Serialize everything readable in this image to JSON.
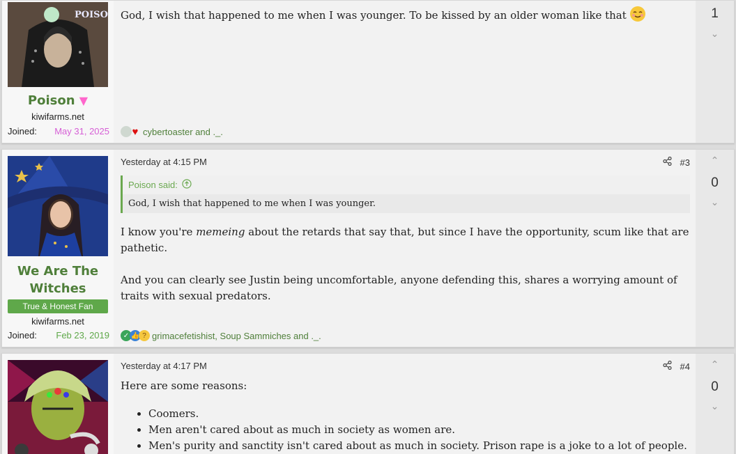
{
  "posts": [
    {
      "username": "Poison",
      "user_flair": "▼",
      "site": "kiwifarms.net",
      "joined_label": "Joined:",
      "joined_date": "May 31, 2025",
      "body": "God, I wish that happened to me when I was younger. To be kissed by an older woman like that",
      "reactions": "cybertoaster and ._.",
      "score": "1"
    },
    {
      "username": "We Are The Witches",
      "badge": "True & Honest Fan",
      "site": "kiwifarms.net",
      "joined_label": "Joined:",
      "joined_date": "Feb 23, 2019",
      "timestamp": "Yesterday at 4:15 PM",
      "post_number": "#3",
      "quote_author": "Poison said:",
      "quote_text": "God, I wish that happened to me when I was younger.",
      "body_p1_a": "I know you're ",
      "body_p1_em": "memeing",
      "body_p1_b": " about the retards that say that, but since I have the opportunity, scum like that are pathetic.",
      "body_p2": "And you can clearly see Justin being uncomfortable, anyone defending this, shares a worrying amount of traits with sexual predators.",
      "reactions": "grimacefetishist, Soup Sammiches and ._.",
      "score": "0"
    },
    {
      "timestamp": "Yesterday at 4:17 PM",
      "post_number": "#4",
      "intro": "Here are some reasons:",
      "list": [
        "Coomers.",
        "Men aren't cared about as much in society as women are.",
        "Men's purity and sanctity isn't cared about as much in society. Prison rape is a joke to a lot of people."
      ],
      "score": "0"
    }
  ],
  "colors": {
    "username": "#4f7f3a",
    "joined_pink": "#d65fd6",
    "joined_green": "#5fa84a",
    "badge": "#5fa84a"
  },
  "icons": {
    "share": "share-icon",
    "vote_up": "chevron-up-icon",
    "vote_down": "chevron-down-icon",
    "quote_jump": "arrow-up-circle-icon"
  }
}
